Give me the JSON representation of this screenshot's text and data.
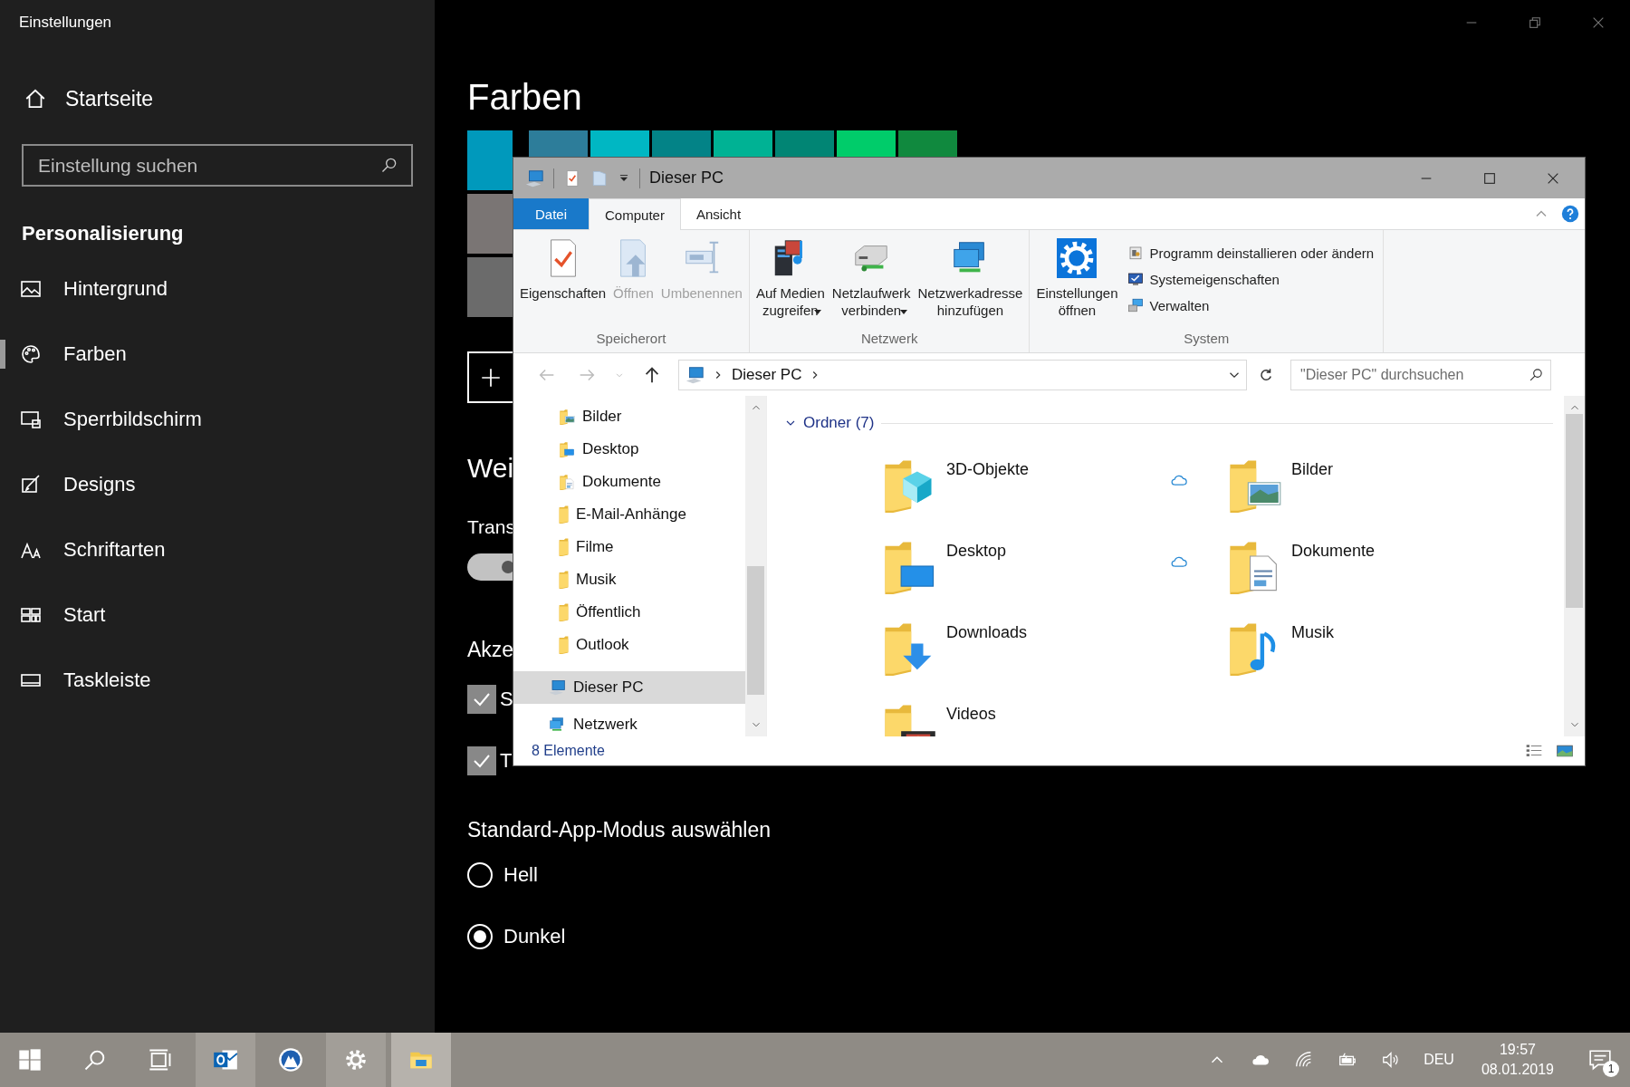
{
  "settings": {
    "title": "Einstellungen",
    "sidebar": {
      "home": "Startseite",
      "search": {
        "placeholder": "Einstellung suchen"
      },
      "section": "Personalisierung",
      "items": [
        {
          "kind": "background",
          "label": "Hintergrund",
          "selected": false
        },
        {
          "kind": "colors",
          "label": "Farben",
          "selected": true
        },
        {
          "kind": "lockscreen",
          "label": "Sperrbildschirm",
          "selected": false
        },
        {
          "kind": "themes",
          "label": "Designs",
          "selected": false
        },
        {
          "kind": "fonts",
          "label": "Schriftarten",
          "selected": false
        },
        {
          "kind": "start",
          "label": "Start",
          "selected": false
        },
        {
          "kind": "taskbar",
          "label": "Taskleiste",
          "selected": false
        }
      ]
    },
    "content": {
      "heading": "Farben",
      "swatch_rows": [
        [
          {
            "color": "#0099bc"
          },
          {
            "color": "#2d7d9a"
          },
          {
            "color": "#00b7c3"
          },
          {
            "color": "#038387"
          },
          {
            "color": "#00b294"
          },
          {
            "color": "#018574"
          },
          {
            "color": "#00cc6a"
          },
          {
            "color": "#10893e"
          }
        ],
        [
          {
            "color": "#7a7574"
          }
        ],
        [
          {
            "color": "#6b6b6b"
          }
        ]
      ],
      "more_heading": "Wei",
      "transparency_label": "Trans",
      "transparency_toggle": {
        "on": false
      },
      "accent_heading": "Akze",
      "checkboxes": [
        {
          "label": "S",
          "checked": true
        },
        {
          "label": "T",
          "checked": true
        }
      ],
      "mode_heading": "Standard-App-Modus auswählen",
      "modes": [
        {
          "label": "Hell",
          "selected": false
        },
        {
          "label": "Dunkel",
          "selected": true
        }
      ]
    }
  },
  "explorer": {
    "title": "Dieser PC",
    "tabs": [
      {
        "kind": "file",
        "label": "Datei",
        "selected": false
      },
      {
        "kind": "tab",
        "label": "Computer",
        "selected": true
      },
      {
        "kind": "tab",
        "label": "Ansicht",
        "selected": false
      }
    ],
    "ribbon": [
      {
        "label": "Speicherort",
        "items": [
          {
            "kind": "properties",
            "label": "Eigenschaften",
            "disabled": false,
            "dropdown": false
          },
          {
            "kind": "open",
            "label": "Öffnen",
            "disabled": true,
            "dropdown": false
          },
          {
            "kind": "rename",
            "label": "Umbenennen",
            "disabled": true,
            "dropdown": false
          }
        ]
      },
      {
        "label": "Netzwerk",
        "items": [
          {
            "kind": "media",
            "label": "Auf Medien\nzugreifen",
            "disabled": false,
            "dropdown": true
          },
          {
            "kind": "netdrive",
            "label": "Netzlaufwerk\nverbinden",
            "disabled": false,
            "dropdown": true
          },
          {
            "kind": "netaddress",
            "label": "Netzwerkadresse\nhinzufügen",
            "disabled": false,
            "dropdown": false
          }
        ]
      },
      {
        "label": "System",
        "items": [
          {
            "kind": "settings",
            "label": "Einstellungen\nöffnen",
            "disabled": false,
            "dropdown": false
          }
        ],
        "links": [
          {
            "kind": "uninstall",
            "label": "Programm deinstallieren oder ändern"
          },
          {
            "kind": "sysprops",
            "label": "Systemeigenschaften"
          },
          {
            "kind": "manage",
            "label": "Verwalten"
          }
        ]
      }
    ],
    "address": {
      "path": [
        "Dieser PC"
      ],
      "search_placeholder": "\"Dieser PC\" durchsuchen"
    },
    "nav": {
      "pinned": [
        {
          "kind": "pictures",
          "label": "Bilder",
          "selected": false
        },
        {
          "kind": "desktop",
          "label": "Desktop",
          "selected": false
        },
        {
          "kind": "documents",
          "label": "Dokumente",
          "selected": false
        },
        {
          "kind": "plain",
          "label": "E-Mail-Anhänge",
          "selected": false
        },
        {
          "kind": "plain",
          "label": "Filme",
          "selected": false
        },
        {
          "kind": "plain",
          "label": "Musik",
          "selected": false
        },
        {
          "kind": "plain",
          "label": "Öffentlich",
          "selected": false
        },
        {
          "kind": "plain",
          "label": "Outlook",
          "selected": false
        }
      ],
      "roots": [
        {
          "kind": "pc",
          "label": "Dieser PC",
          "selected": true
        },
        {
          "kind": "network",
          "label": "Netzwerk",
          "selected": false
        }
      ]
    },
    "group": {
      "label": "Ordner (7)",
      "expanded": true
    },
    "folders": [
      {
        "kind": "objects3d",
        "name": "3D-Objekte",
        "synced": true
      },
      {
        "kind": "pictures",
        "name": "Bilder",
        "synced": false
      },
      {
        "kind": "desktop",
        "name": "Desktop",
        "synced": true
      },
      {
        "kind": "documents",
        "name": "Dokumente",
        "synced": false
      },
      {
        "kind": "downloads",
        "name": "Downloads",
        "synced": false
      },
      {
        "kind": "music",
        "name": "Musik",
        "synced": false
      },
      {
        "kind": "videos",
        "name": "Videos",
        "synced": false
      }
    ],
    "status": "8 Elemente"
  },
  "taskbar": {
    "apps": [
      {
        "kind": "start",
        "running": false,
        "active": false
      },
      {
        "kind": "search",
        "running": false,
        "active": false
      },
      {
        "kind": "taskview",
        "running": false,
        "active": false
      },
      {
        "kind": "outlook",
        "running": true,
        "active": false
      },
      {
        "kind": "mountain",
        "running": false,
        "active": false
      },
      {
        "kind": "settings",
        "running": true,
        "active": false
      },
      {
        "kind": "explorer",
        "running": true,
        "active": true
      }
    ],
    "language": "DEU",
    "time": "19:57",
    "date": "08.01.2019",
    "notifications": "1"
  }
}
